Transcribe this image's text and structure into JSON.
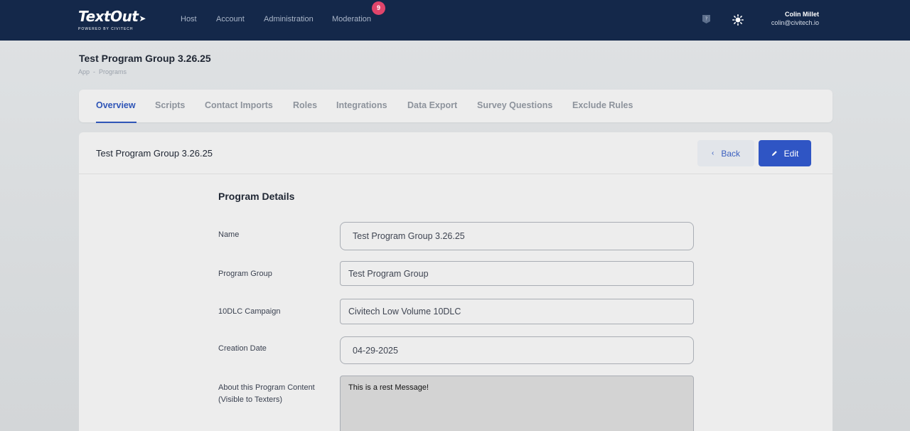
{
  "brand": {
    "name": "TextOut",
    "tagline": "POWERED BY CIVITECH"
  },
  "nav": {
    "items": [
      {
        "label": "Host"
      },
      {
        "label": "Account"
      },
      {
        "label": "Administration"
      },
      {
        "label": "Moderation"
      }
    ],
    "moderation_badge": "9"
  },
  "user": {
    "name": "Colin Millet",
    "email": "colin@civitech.io"
  },
  "page": {
    "title": "Test Program Group 3.26.25",
    "breadcrumb": [
      "App",
      "Programs"
    ],
    "breadcrumb_sep": "-"
  },
  "tabs": [
    {
      "label": "Overview",
      "active": true
    },
    {
      "label": "Scripts"
    },
    {
      "label": "Contact Imports"
    },
    {
      "label": "Roles"
    },
    {
      "label": "Integrations"
    },
    {
      "label": "Data Export"
    },
    {
      "label": "Survey Questions"
    },
    {
      "label": "Exclude Rules"
    }
  ],
  "card": {
    "title": "Test Program Group 3.26.25",
    "back_label": "Back",
    "edit_label": "Edit"
  },
  "details": {
    "section_title": "Program Details",
    "fields": [
      {
        "label": "Name",
        "value": "Test Program Group 3.26.25"
      },
      {
        "label": "Program Group",
        "value": "Test Program Group"
      },
      {
        "label": "10DLC Campaign",
        "value": "Civitech Low Volume 10DLC"
      },
      {
        "label": "Creation Date",
        "value": "04-29-2025"
      }
    ],
    "about": {
      "label_line1": "About this Program Content",
      "label_line2": "(Visible to Texters)",
      "value": "This is a rest Message!"
    }
  },
  "colors": {
    "topbar": "#14284a",
    "accent": "#2f55c4",
    "badge": "#e0456b"
  }
}
